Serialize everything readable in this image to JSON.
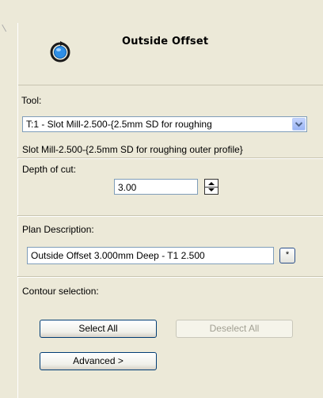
{
  "header": {
    "title": "Outside Offset",
    "icon": "outside-offset-icon"
  },
  "tool": {
    "label": "Tool:",
    "selected": "T:1 - Slot Mill-2.500-{2.5mm SD for roughing",
    "description": "Slot Mill-2.500-{2.5mm SD for roughing outer profile}"
  },
  "depth": {
    "label": "Depth of cut:",
    "value": "3.00"
  },
  "plan": {
    "label": "Plan Description:",
    "value": "Outside Offset 3.000mm Deep - T1 2.500",
    "more_label": "*"
  },
  "contour": {
    "label": "Contour selection:",
    "select_all": "Select All",
    "deselect_all": "Deselect All",
    "advanced": "Advanced >"
  }
}
